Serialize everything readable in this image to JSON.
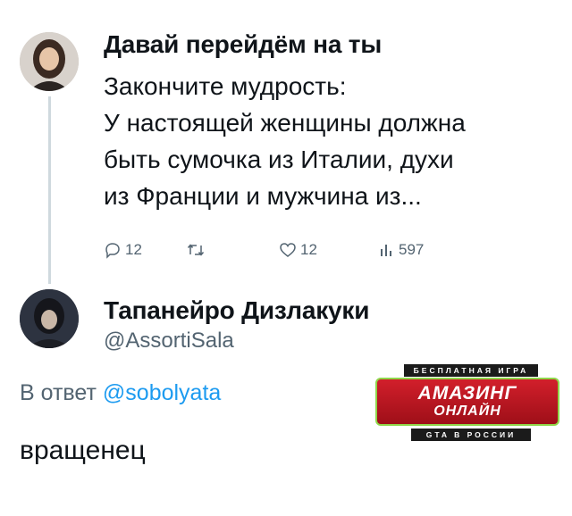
{
  "tweet": {
    "author_name": "Давай перейдём на ты",
    "lines": [
      "Закончите мудрость:",
      "У настоящей женщины должна",
      "быть сумочка из Италии, духи",
      "из Франции и мужчина из..."
    ],
    "actions": {
      "replies": "12",
      "retweets": "",
      "likes": "12",
      "views": "597"
    }
  },
  "reply": {
    "author_name": "Тапанейро Дизлакуки",
    "handle": "@AssortiSala",
    "reply_to_prefix": "В ответ",
    "reply_to_mention": "@sobolyata",
    "text": "вращенец"
  },
  "promo": {
    "top": "БЕСПЛАТНАЯ ИГРА",
    "line1": "АМАЗИНГ",
    "line2": "ОНЛАЙН",
    "bottom": "GTA В РОССИИ"
  },
  "colors": {
    "text": "#0f1419",
    "secondary": "#536471",
    "link": "#1d9bf0",
    "promo_red": "#d21f2b",
    "promo_border": "#8fd64a"
  }
}
